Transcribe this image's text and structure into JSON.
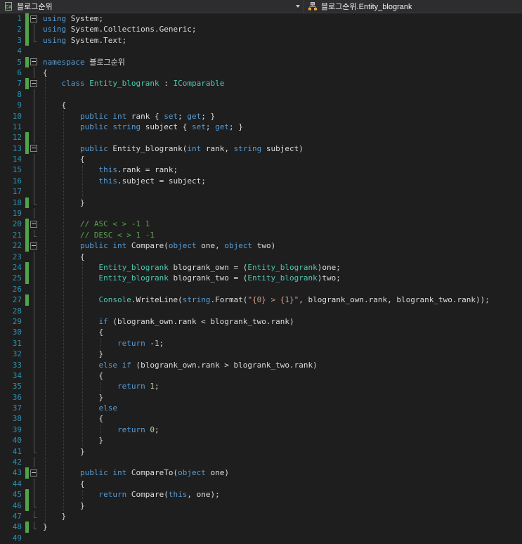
{
  "navbar": {
    "project_dropdown": {
      "label": "블로그순위",
      "icon": "csharp-file-icon"
    },
    "member_dropdown": {
      "label": "블로그순위.Entity_blogrank",
      "icon": "class-icon"
    }
  },
  "colors": {
    "editor_bg": "#1E1E1E",
    "navbar_bg": "#2D2D30",
    "navbar_border": "#3E3E42",
    "navbar_text": "#F1F1F1",
    "line_number": "#2B91AF",
    "change_bar": "#4FA348",
    "outline": "#5A5A5A",
    "indent_guide": "#3F3F46",
    "keyword": "#569CD6",
    "type": "#4EC9B0",
    "comment": "#57A64A",
    "string": "#D69D85",
    "number": "#B5CEA8",
    "plain": "#DCDCDC"
  },
  "editor": {
    "changed_lines": [
      1,
      2,
      3,
      5,
      7,
      12,
      13,
      18,
      20,
      21,
      22,
      24,
      25,
      27,
      43,
      45,
      46,
      48
    ],
    "fold_open_lines": [
      1,
      5,
      7,
      13,
      20,
      22,
      43
    ],
    "fold_end_lines": [
      3,
      18,
      21,
      41,
      46,
      47,
      48
    ],
    "fold_mid_lines": [
      2,
      6,
      8,
      9,
      10,
      11,
      12,
      14,
      15,
      16,
      17,
      19,
      23,
      24,
      25,
      26,
      27,
      28,
      29,
      30,
      31,
      32,
      33,
      34,
      35,
      36,
      37,
      38,
      39,
      40,
      42,
      44,
      45
    ],
    "indent_guides": [
      {
        "col": 0,
        "from": 7,
        "to": 47
      },
      {
        "col": 4,
        "from": 10,
        "to": 46
      },
      {
        "col": 8,
        "from": 15,
        "to": 17
      },
      {
        "col": 8,
        "from": 24,
        "to": 40
      },
      {
        "col": 12,
        "from": 31,
        "to": 31
      },
      {
        "col": 12,
        "from": 35,
        "to": 35
      },
      {
        "col": 12,
        "from": 39,
        "to": 39
      },
      {
        "col": 8,
        "from": 45,
        "to": 45
      }
    ],
    "lines": [
      {
        "n": 1,
        "tokens": [
          [
            "k",
            "using"
          ],
          [
            "p",
            " System;"
          ]
        ]
      },
      {
        "n": 2,
        "tokens": [
          [
            "k",
            "using"
          ],
          [
            "p",
            " System.Collections.Generic;"
          ]
        ]
      },
      {
        "n": 3,
        "tokens": [
          [
            "k",
            "using"
          ],
          [
            "p",
            " System.Text;"
          ]
        ]
      },
      {
        "n": 4,
        "tokens": []
      },
      {
        "n": 5,
        "tokens": [
          [
            "k",
            "namespace"
          ],
          [
            "p",
            " 블로그순위"
          ]
        ]
      },
      {
        "n": 6,
        "tokens": [
          [
            "p",
            "{"
          ]
        ]
      },
      {
        "n": 7,
        "tokens": [
          [
            "p",
            "    "
          ],
          [
            "k",
            "class"
          ],
          [
            "p",
            " "
          ],
          [
            "t",
            "Entity_blogrank"
          ],
          [
            "p",
            " : "
          ],
          [
            "t",
            "IComparable"
          ]
        ]
      },
      {
        "n": 8,
        "tokens": []
      },
      {
        "n": 9,
        "tokens": [
          [
            "p",
            "    {"
          ]
        ]
      },
      {
        "n": 10,
        "tokens": [
          [
            "p",
            "        "
          ],
          [
            "k",
            "public"
          ],
          [
            "p",
            " "
          ],
          [
            "k",
            "int"
          ],
          [
            "p",
            " rank { "
          ],
          [
            "k",
            "set"
          ],
          [
            "p",
            "; "
          ],
          [
            "k",
            "get"
          ],
          [
            "p",
            "; }"
          ]
        ]
      },
      {
        "n": 11,
        "tokens": [
          [
            "p",
            "        "
          ],
          [
            "k",
            "public"
          ],
          [
            "p",
            " "
          ],
          [
            "k",
            "string"
          ],
          [
            "p",
            " subject { "
          ],
          [
            "k",
            "set"
          ],
          [
            "p",
            "; "
          ],
          [
            "k",
            "get"
          ],
          [
            "p",
            "; }"
          ]
        ]
      },
      {
        "n": 12,
        "tokens": []
      },
      {
        "n": 13,
        "tokens": [
          [
            "p",
            "        "
          ],
          [
            "k",
            "public"
          ],
          [
            "p",
            " Entity_blogrank("
          ],
          [
            "k",
            "int"
          ],
          [
            "p",
            " rank, "
          ],
          [
            "k",
            "string"
          ],
          [
            "p",
            " subject)"
          ]
        ]
      },
      {
        "n": 14,
        "tokens": [
          [
            "p",
            "        {"
          ]
        ]
      },
      {
        "n": 15,
        "tokens": [
          [
            "p",
            "            "
          ],
          [
            "k",
            "this"
          ],
          [
            "p",
            ".rank = rank;"
          ]
        ]
      },
      {
        "n": 16,
        "tokens": [
          [
            "p",
            "            "
          ],
          [
            "k",
            "this"
          ],
          [
            "p",
            ".subject = subject;"
          ]
        ]
      },
      {
        "n": 17,
        "tokens": []
      },
      {
        "n": 18,
        "tokens": [
          [
            "p",
            "        }"
          ]
        ]
      },
      {
        "n": 19,
        "tokens": []
      },
      {
        "n": 20,
        "tokens": [
          [
            "p",
            "        "
          ],
          [
            "c",
            "// ASC < > -1 1"
          ]
        ]
      },
      {
        "n": 21,
        "tokens": [
          [
            "p",
            "        "
          ],
          [
            "c",
            "// DESC < > 1 -1"
          ]
        ]
      },
      {
        "n": 22,
        "tokens": [
          [
            "p",
            "        "
          ],
          [
            "k",
            "public"
          ],
          [
            "p",
            " "
          ],
          [
            "k",
            "int"
          ],
          [
            "p",
            " Compare("
          ],
          [
            "k",
            "object"
          ],
          [
            "p",
            " one, "
          ],
          [
            "k",
            "object"
          ],
          [
            "p",
            " two)"
          ]
        ]
      },
      {
        "n": 23,
        "tokens": [
          [
            "p",
            "        {"
          ]
        ]
      },
      {
        "n": 24,
        "tokens": [
          [
            "p",
            "            "
          ],
          [
            "t",
            "Entity_blogrank"
          ],
          [
            "p",
            " blogrank_own = ("
          ],
          [
            "t",
            "Entity_blogrank"
          ],
          [
            "p",
            ")one;"
          ]
        ]
      },
      {
        "n": 25,
        "tokens": [
          [
            "p",
            "            "
          ],
          [
            "t",
            "Entity_blogrank"
          ],
          [
            "p",
            " blogrank_two = ("
          ],
          [
            "t",
            "Entity_blogrank"
          ],
          [
            "p",
            ")two;"
          ]
        ]
      },
      {
        "n": 26,
        "tokens": []
      },
      {
        "n": 27,
        "tokens": [
          [
            "p",
            "            "
          ],
          [
            "t",
            "Console"
          ],
          [
            "p",
            ".WriteLine("
          ],
          [
            "k",
            "string"
          ],
          [
            "p",
            ".Format("
          ],
          [
            "s",
            "\"{0} > {1}\""
          ],
          [
            "p",
            ", blogrank_own.rank, blogrank_two.rank));"
          ]
        ]
      },
      {
        "n": 28,
        "tokens": []
      },
      {
        "n": 29,
        "tokens": [
          [
            "p",
            "            "
          ],
          [
            "k",
            "if"
          ],
          [
            "p",
            " (blogrank_own.rank < blogrank_two.rank)"
          ]
        ]
      },
      {
        "n": 30,
        "tokens": [
          [
            "p",
            "            {"
          ]
        ]
      },
      {
        "n": 31,
        "tokens": [
          [
            "p",
            "                "
          ],
          [
            "k",
            "return"
          ],
          [
            "p",
            " -"
          ],
          [
            "num",
            "1"
          ],
          [
            "p",
            ";"
          ]
        ]
      },
      {
        "n": 32,
        "tokens": [
          [
            "p",
            "            }"
          ]
        ]
      },
      {
        "n": 33,
        "tokens": [
          [
            "p",
            "            "
          ],
          [
            "k",
            "else"
          ],
          [
            "p",
            " "
          ],
          [
            "k",
            "if"
          ],
          [
            "p",
            " (blogrank_own.rank > blogrank_two.rank)"
          ]
        ]
      },
      {
        "n": 34,
        "tokens": [
          [
            "p",
            "            {"
          ]
        ]
      },
      {
        "n": 35,
        "tokens": [
          [
            "p",
            "                "
          ],
          [
            "k",
            "return"
          ],
          [
            "p",
            " "
          ],
          [
            "num",
            "1"
          ],
          [
            "p",
            ";"
          ]
        ]
      },
      {
        "n": 36,
        "tokens": [
          [
            "p",
            "            }"
          ]
        ]
      },
      {
        "n": 37,
        "tokens": [
          [
            "p",
            "            "
          ],
          [
            "k",
            "else"
          ]
        ]
      },
      {
        "n": 38,
        "tokens": [
          [
            "p",
            "            {"
          ]
        ]
      },
      {
        "n": 39,
        "tokens": [
          [
            "p",
            "                "
          ],
          [
            "k",
            "return"
          ],
          [
            "p",
            " "
          ],
          [
            "num",
            "0"
          ],
          [
            "p",
            ";"
          ]
        ]
      },
      {
        "n": 40,
        "tokens": [
          [
            "p",
            "            }"
          ]
        ]
      },
      {
        "n": 41,
        "tokens": [
          [
            "p",
            "        }"
          ]
        ]
      },
      {
        "n": 42,
        "tokens": []
      },
      {
        "n": 43,
        "tokens": [
          [
            "p",
            "        "
          ],
          [
            "k",
            "public"
          ],
          [
            "p",
            " "
          ],
          [
            "k",
            "int"
          ],
          [
            "p",
            " CompareTo("
          ],
          [
            "k",
            "object"
          ],
          [
            "p",
            " one)"
          ]
        ]
      },
      {
        "n": 44,
        "tokens": [
          [
            "p",
            "        {"
          ]
        ]
      },
      {
        "n": 45,
        "tokens": [
          [
            "p",
            "            "
          ],
          [
            "k",
            "return"
          ],
          [
            "p",
            " Compare("
          ],
          [
            "k",
            "this"
          ],
          [
            "p",
            ", one);"
          ]
        ]
      },
      {
        "n": 46,
        "tokens": [
          [
            "p",
            "        }"
          ]
        ]
      },
      {
        "n": 47,
        "tokens": [
          [
            "p",
            "    }"
          ]
        ]
      },
      {
        "n": 48,
        "tokens": [
          [
            "p",
            "}"
          ]
        ]
      },
      {
        "n": 49,
        "tokens": []
      }
    ]
  }
}
